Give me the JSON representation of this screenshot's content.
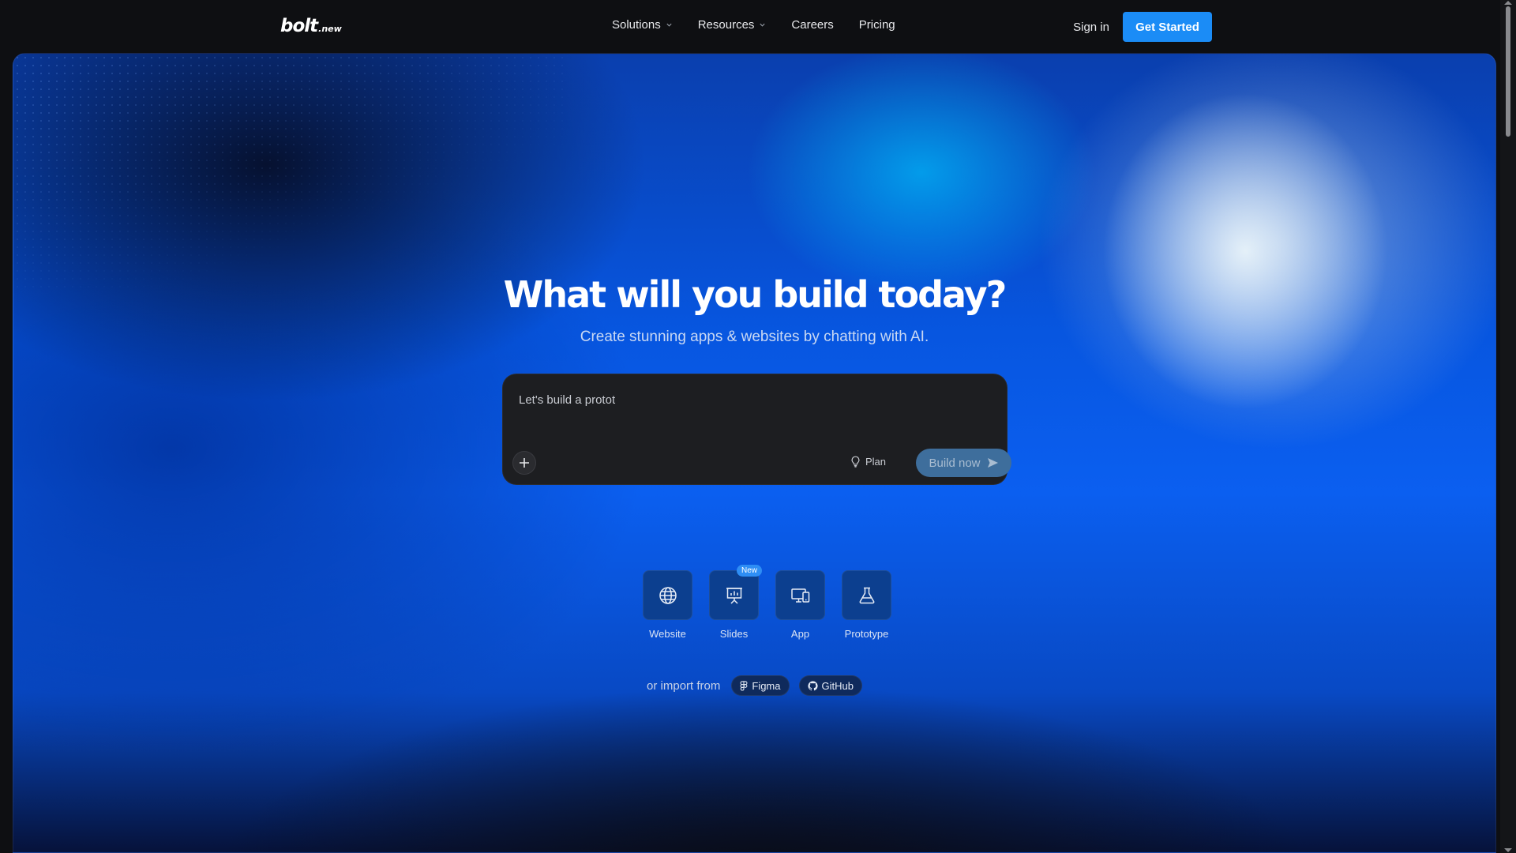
{
  "brand": {
    "logo_main": "bolt",
    "logo_suffix": ".new"
  },
  "nav": {
    "items": [
      {
        "label": "Solutions",
        "has_dropdown": true
      },
      {
        "label": "Resources",
        "has_dropdown": true
      },
      {
        "label": "Careers",
        "has_dropdown": false
      },
      {
        "label": "Pricing",
        "has_dropdown": false
      }
    ],
    "sign_in": "Sign in",
    "get_started": "Get Started"
  },
  "hero": {
    "title": "What will you build today?",
    "subtitle": "Create stunning apps & websites by chatting with AI."
  },
  "prompt": {
    "value": "Let's build a protot",
    "plan_label": "Plan",
    "build_label": "Build now",
    "add_icon": "plus-icon",
    "plan_icon": "lightbulb-icon",
    "build_icon": "send-icon"
  },
  "categories": [
    {
      "label": "Website",
      "icon": "globe-icon",
      "badge": ""
    },
    {
      "label": "Slides",
      "icon": "presentation-icon",
      "badge": "New"
    },
    {
      "label": "App",
      "icon": "devices-icon",
      "badge": ""
    },
    {
      "label": "Prototype",
      "icon": "flask-icon",
      "badge": ""
    }
  ],
  "import": {
    "label": "or import from",
    "sources": [
      {
        "label": "Figma",
        "icon": "figma-icon"
      },
      {
        "label": "GitHub",
        "icon": "github-icon"
      }
    ]
  },
  "colors": {
    "accent": "#1b8cf6",
    "background": "#0e0f12",
    "prompt_bg": "#1d1e21",
    "tile_bg": "#0c3f8f",
    "build_button_bg": "#3e6e9c"
  }
}
